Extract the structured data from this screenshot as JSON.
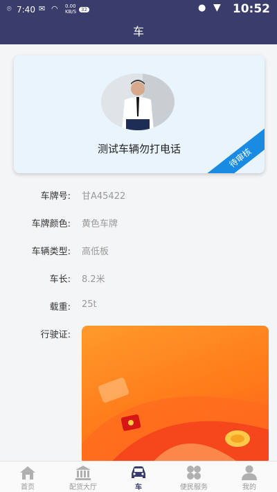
{
  "status_bar": {
    "time": "7:40",
    "net_speed_top": "0.00",
    "net_speed_bottom": "KB/S",
    "badge": "32",
    "clock": "10:52"
  },
  "header": {
    "title": "车"
  },
  "vehicle_card": {
    "name": "测试车辆勿打电话",
    "status": "待审核"
  },
  "details": [
    {
      "label": "车牌号:",
      "value": "甘A45422"
    },
    {
      "label": "车牌颜色:",
      "value": "黄色车牌"
    },
    {
      "label": "车辆类型:",
      "value": "高低板"
    },
    {
      "label": "车长:",
      "value": "8.2米"
    },
    {
      "label": "载重:",
      "value": "25t"
    }
  ],
  "license_label": "行驶证:",
  "tabs": [
    {
      "label": "首页",
      "icon": "home-icon"
    },
    {
      "label": "配货大厅",
      "icon": "bank-icon"
    },
    {
      "label": "车",
      "icon": "car-icon",
      "active": true
    },
    {
      "label": "便民服务",
      "icon": "grid-icon"
    },
    {
      "label": "我的",
      "icon": "user-icon"
    }
  ],
  "colors": {
    "primary": "#3a3d6b",
    "ribbon": "#1a8be3",
    "license_bg": "#ff7a1a"
  }
}
